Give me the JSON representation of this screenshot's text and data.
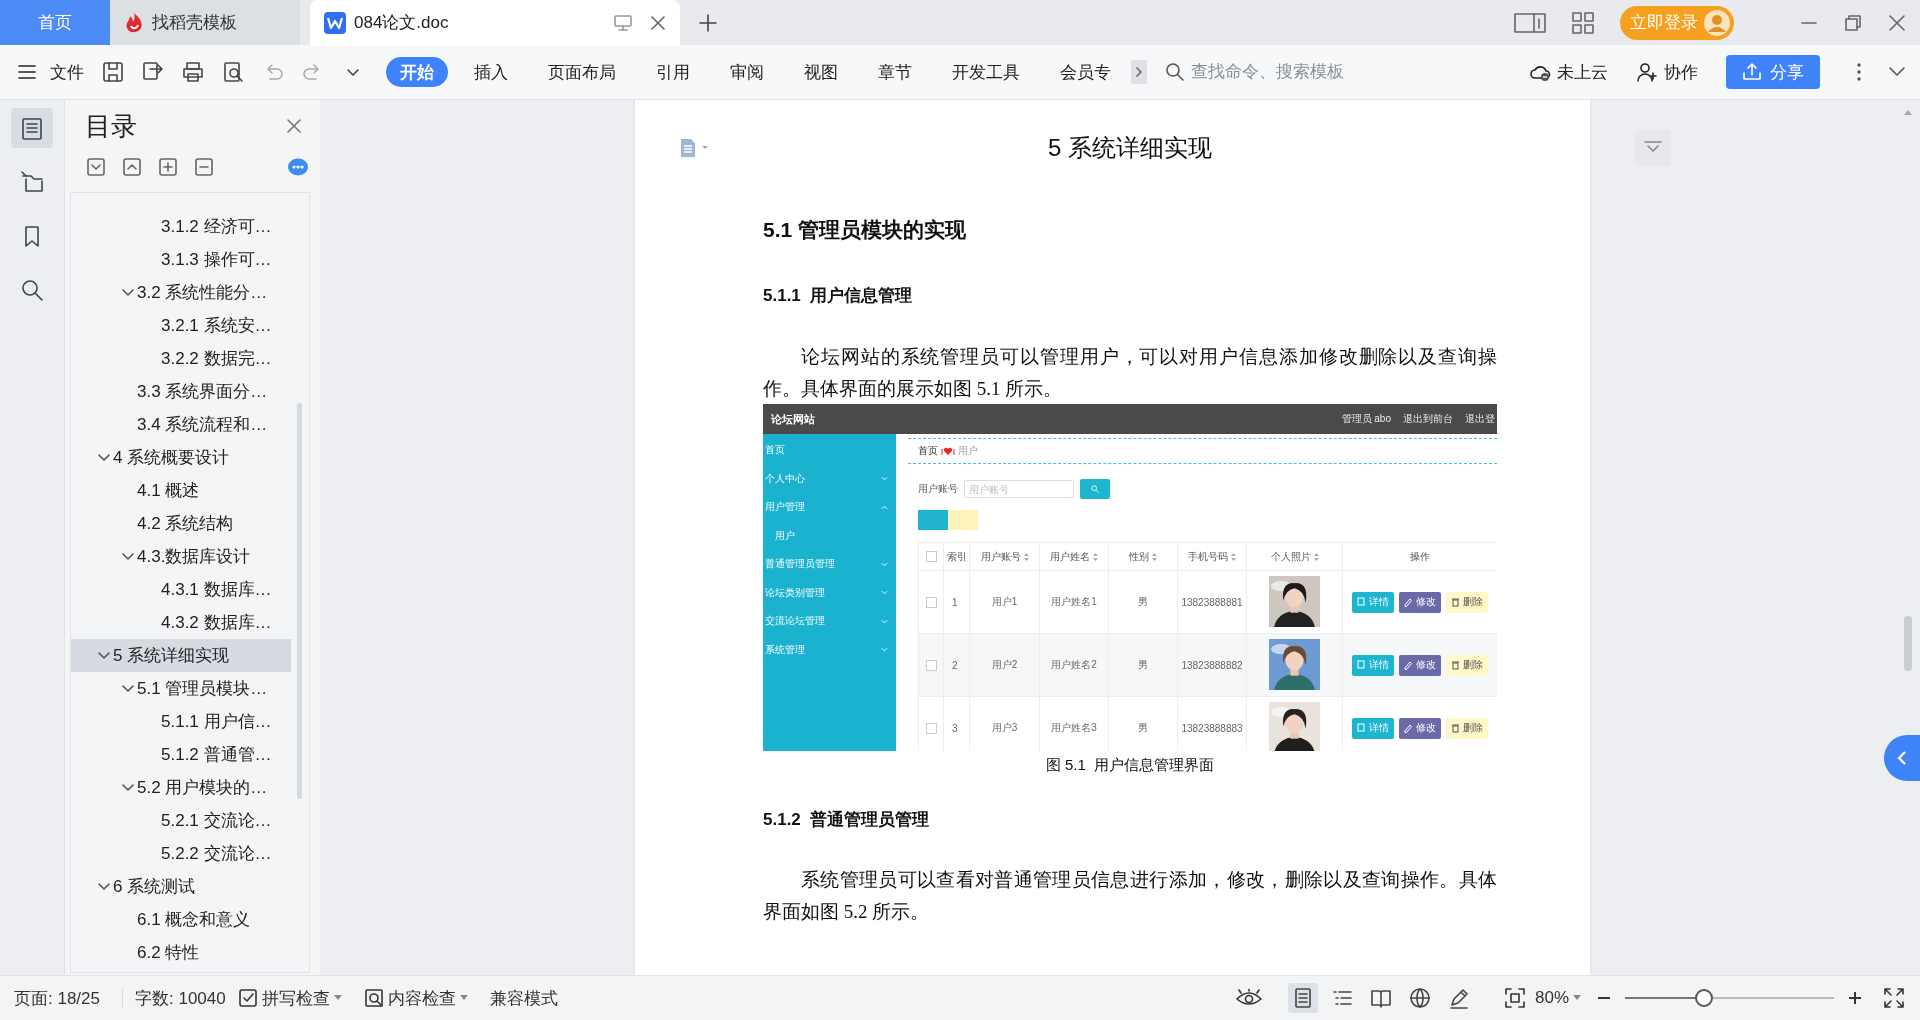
{
  "tabs": [
    {
      "label": "首页",
      "kind": "home",
      "selected": false
    },
    {
      "label": "找稻壳模板",
      "kind": "docer",
      "selected": false
    },
    {
      "label": "084论文.doc",
      "kind": "doc",
      "selected": true
    }
  ],
  "login_button": "立即登录",
  "toolbar": {
    "file_menu": "文件",
    "ribbon_tabs": [
      {
        "label": "开始",
        "selected": true
      },
      {
        "label": "插入",
        "selected": false
      },
      {
        "label": "页面布局",
        "selected": false
      },
      {
        "label": "引用",
        "selected": false
      },
      {
        "label": "审阅",
        "selected": false
      },
      {
        "label": "视图",
        "selected": false
      },
      {
        "label": "章节",
        "selected": false
      },
      {
        "label": "开发工具",
        "selected": false
      },
      {
        "label": "会员专",
        "selected": false
      }
    ],
    "search": {
      "placeholder": "查找命令、搜索模板"
    },
    "cloud": "未上云",
    "collaborate": "协作",
    "share": "分享"
  },
  "rail": [
    {
      "kind": "toc",
      "selected": true
    },
    {
      "kind": "navigation",
      "selected": false
    },
    {
      "kind": "bookmark",
      "selected": false
    },
    {
      "kind": "search",
      "selected": false
    }
  ],
  "toc": {
    "title": "目录",
    "items": [
      {
        "children": [
          {
            "children": [
              {
                "label": "3.1.2 经济可…",
                "selected": false
              },
              {
                "label": "3.1.3 操作可…",
                "selected": false
              }
            ]
          },
          {
            "label": "3.2 系统性能分…",
            "expanded": true,
            "selected": false,
            "children": [
              {
                "label": "3.2.1  系统安…",
                "selected": false
              },
              {
                "label": "3.2.2  数据完…",
                "selected": false
              }
            ]
          },
          {
            "label": "3.3 系统界面分…",
            "selected": false
          },
          {
            "label": "3.4 系统流程和…",
            "selected": false
          }
        ]
      },
      {
        "label": "4 系统概要设计",
        "expanded": true,
        "selected": false,
        "children": [
          {
            "label": "4.1 概述",
            "selected": false
          },
          {
            "label": "4.2 系统结构",
            "selected": false
          },
          {
            "label": "4.3.数据库设计",
            "expanded": true,
            "selected": false,
            "children": [
              {
                "label": "4.3.1 数据库…",
                "selected": false
              },
              {
                "label": "4.3.2 数据库…",
                "selected": false
              }
            ]
          }
        ]
      },
      {
        "label": "5 系统详细实现",
        "expanded": true,
        "selected": true,
        "children": [
          {
            "label": "5.1  管理员模块…",
            "expanded": true,
            "selected": false,
            "children": [
              {
                "label": "5.1.1  用户信…",
                "selected": false
              },
              {
                "label": "5.1.2  普通管…",
                "selected": false
              }
            ]
          },
          {
            "label": "5.2  用户模块的…",
            "expanded": true,
            "selected": false,
            "children": [
              {
                "label": "5.2.1  交流论…",
                "selected": false
              },
              {
                "label": "5.2.2  交流论…",
                "selected": false
              }
            ]
          }
        ]
      },
      {
        "label": "6 系统测试",
        "expanded": true,
        "selected": false,
        "children": [
          {
            "label": "6.1 概念和意义",
            "selected": false
          },
          {
            "label": "6.2 特性",
            "selected": false
          }
        ]
      }
    ]
  },
  "document": {
    "chapter": "5 系统详细实现",
    "section": "5.1  管理员模块的实现",
    "subsection_1": "5.1.1  用户信息管理",
    "paragraph_1": "论坛网站的系统管理员可以管理用户，可以对用户信息添加修改删除以及查询操作。具体界面的展示如图 5.1 所示。",
    "figure": {
      "site_title": "论坛网站",
      "header_links": [
        "管理员 abo",
        "退出到前台",
        "退出登"
      ],
      "nav": [
        {
          "label": "首页",
          "kind": "link"
        },
        {
          "label": "个人中心",
          "kind": "menu",
          "expanded": false
        },
        {
          "label": "用户管理",
          "kind": "menu",
          "expanded": true,
          "children": [
            {
              "label": "用户",
              "kind": "link"
            }
          ]
        },
        {
          "label": "普通管理员管理",
          "kind": "menu",
          "expanded": false
        },
        {
          "label": "论坛类别管理",
          "kind": "menu",
          "expanded": false
        },
        {
          "label": "交流论坛管理",
          "kind": "menu",
          "expanded": false
        },
        {
          "label": "系统管理",
          "kind": "menu",
          "expanded": false
        }
      ],
      "breadcrumb": [
        "首页",
        "用户"
      ],
      "search_label": "用户账号",
      "search_placeholder": "用户账号",
      "select_all": {
        "checked": false
      },
      "columns": [
        {
          "label": "索引",
          "sortable": false
        },
        {
          "label": "用户账号",
          "sortable": true
        },
        {
          "label": "用户姓名",
          "sortable": true
        },
        {
          "label": "性别",
          "sortable": true
        },
        {
          "label": "手机号码",
          "sortable": true
        },
        {
          "label": "个人照片",
          "sortable": true
        },
        {
          "label": "操作",
          "sortable": false
        }
      ],
      "rows": [
        {
          "checked": false,
          "index": "1",
          "account": "用户1",
          "name": "用户姓名1",
          "gender": "男",
          "phone": "13823888881",
          "actions": [
            {
              "label": "详情",
              "kind": "detail"
            },
            {
              "label": "修改",
              "kind": "edit"
            },
            {
              "label": "删除",
              "kind": "delete"
            }
          ]
        },
        {
          "checked": false,
          "index": "2",
          "account": "用户2",
          "name": "用户姓名2",
          "gender": "男",
          "phone": "13823888882",
          "actions": [
            {
              "label": "详情",
              "kind": "detail"
            },
            {
              "label": "修改",
              "kind": "edit"
            },
            {
              "label": "删除",
              "kind": "delete"
            }
          ]
        },
        {
          "checked": false,
          "index": "3",
          "account": "用户3",
          "name": "用户姓名3",
          "gender": "男",
          "phone": "13823888883",
          "actions": [
            {
              "label": "详情",
              "kind": "detail"
            },
            {
              "label": "修改",
              "kind": "edit"
            },
            {
              "label": "删除",
              "kind": "delete"
            }
          ]
        }
      ]
    },
    "caption": "图 5.1  用户信息管理界面",
    "subsection_2": "5.1.2  普通管理员管理",
    "paragraph_2": "系统管理员可以查看对普通管理员信息进行添加，修改，删除以及查询操作。具体界面如图 5.2 所示。"
  },
  "status": {
    "page": "页面: 18/25",
    "words": "字数: 10040",
    "spell_check": "拼写检查",
    "content_check": "内容检查",
    "mode": "兼容模式",
    "view_modes": [
      {
        "kind": "page",
        "selected": true
      },
      {
        "kind": "outline",
        "selected": false
      },
      {
        "kind": "reading",
        "selected": false
      },
      {
        "kind": "web",
        "selected": false
      },
      {
        "kind": "write",
        "selected": false
      }
    ],
    "zoom": "80%",
    "zoom_slider": {
      "level": 0.38
    }
  }
}
